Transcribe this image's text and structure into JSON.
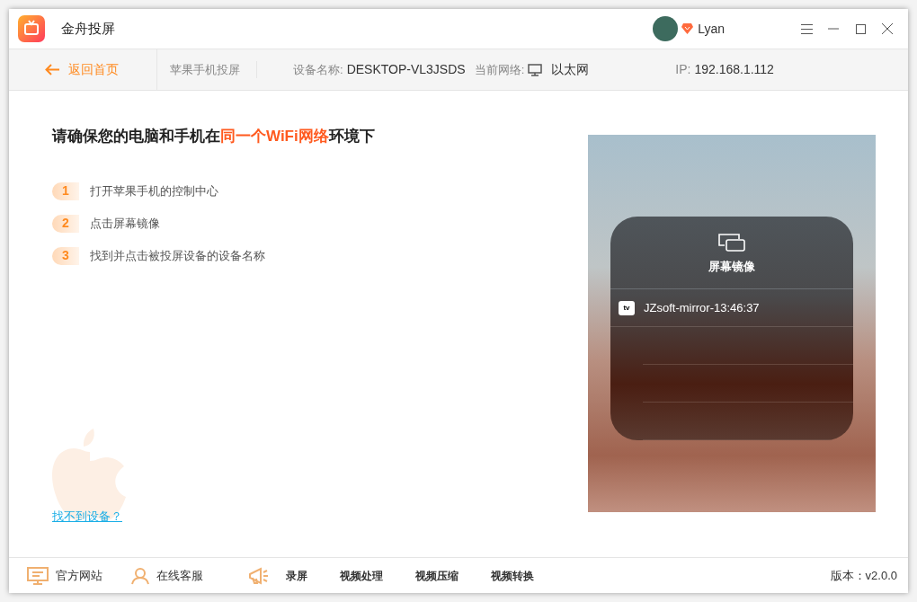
{
  "window": {
    "title": "金舟投屏",
    "user": "Lyan"
  },
  "nav": {
    "back": "返回首页",
    "section": "苹果手机投屏",
    "device_label": "设备名称:",
    "device_name": "DESKTOP-VL3JSDS",
    "network_label": "当前网络:",
    "network": "以太网",
    "ip_label": "IP:",
    "ip": "192.168.1.112"
  },
  "main": {
    "heading": "请确保您的电脑和手机在**同一个WiFi网络**环境下",
    "steps": [
      {
        "number": "1",
        "text": "打开苹果手机的控制中心"
      },
      {
        "number": "2",
        "text": "点击屏幕镜像"
      },
      {
        "number": "3",
        "text": "找到并点击被投屏设备的设备名称"
      }
    ],
    "help_link": "找不到设备？"
  },
  "phone": {
    "panel_title": "屏幕镜像",
    "devices": [
      {
        "badge": "tv",
        "name": "JZsoft-mirror-13:46:37"
      }
    ]
  },
  "footer": {
    "links": [
      {
        "kind": "website",
        "label": "官方网站"
      },
      {
        "kind": "support",
        "label": "在线客服"
      }
    ],
    "tools": [
      "录屏",
      "视频处理",
      "视频压缩",
      "视频转换"
    ],
    "version": "版本：v2.0.0"
  }
}
